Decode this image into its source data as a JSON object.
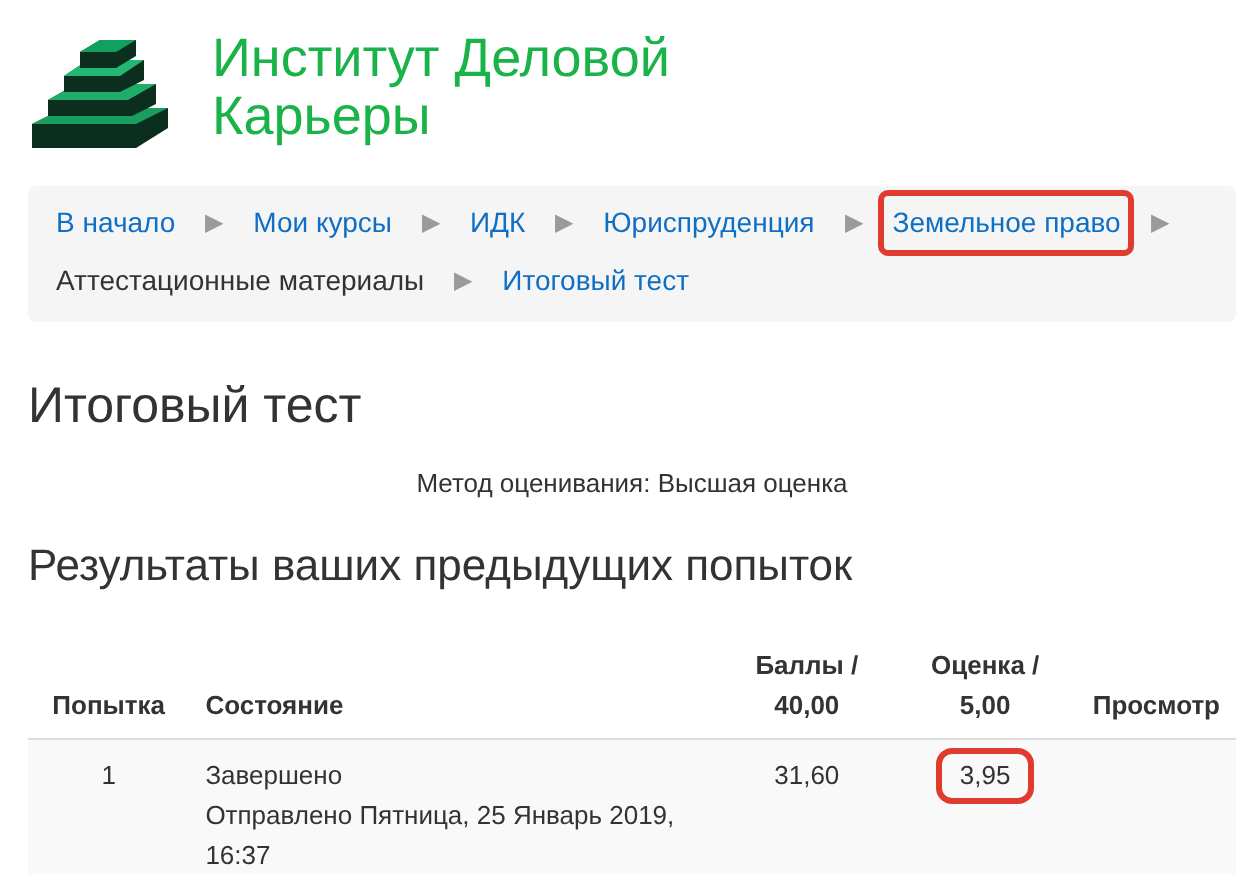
{
  "logo": {
    "title": "Институт Деловой Карьеры"
  },
  "breadcrumb_separator": "▶",
  "breadcrumb": [
    {
      "label": "В начало",
      "link": true,
      "highlighted": false
    },
    {
      "label": "Мои курсы",
      "link": true,
      "highlighted": false
    },
    {
      "label": "ИДК",
      "link": true,
      "highlighted": false
    },
    {
      "label": "Юриспруденция",
      "link": true,
      "highlighted": false
    },
    {
      "label": "Земельное право",
      "link": true,
      "highlighted": true
    },
    {
      "label": "Аттестационные материалы",
      "link": false,
      "highlighted": false
    },
    {
      "label": "Итоговый тест",
      "link": true,
      "highlighted": false
    }
  ],
  "heading": "Итоговый тест",
  "grading_method": "Метод оценивания: Высшая оценка",
  "results_heading": "Результаты ваших предыдущих попыток",
  "table": {
    "columns": [
      {
        "line1": "Попытка"
      },
      {
        "line1": "Состояние"
      },
      {
        "line1": "Баллы /",
        "line2": "40,00"
      },
      {
        "line1": "Оценка /",
        "line2": "5,00"
      },
      {
        "line1": "Просмотр"
      }
    ],
    "rows": [
      {
        "attempt": "1",
        "status": "Завершено",
        "submitted": "Отправлено Пятница, 25 Январь 2019, 16:37",
        "points": "31,60",
        "grade": "3,95",
        "grade_highlighted": true
      }
    ]
  }
}
